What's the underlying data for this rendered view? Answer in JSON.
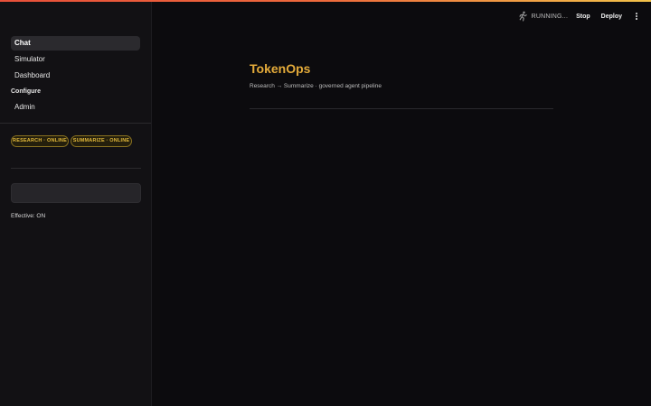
{
  "header": {
    "status_text": "RUNNING...",
    "stop_label": "Stop",
    "deploy_label": "Deploy"
  },
  "sidebar": {
    "nav_items": [
      {
        "label": "Chat",
        "active": true
      },
      {
        "label": "Simulator",
        "active": false
      },
      {
        "label": "Dashboard",
        "active": false
      }
    ],
    "configure_label": "Configure",
    "configure_items": [
      {
        "label": "Admin"
      }
    ],
    "badges": [
      {
        "label": "RESEARCH · ONLINE"
      },
      {
        "label": "SUMMARIZE · ONLINE"
      }
    ],
    "input_value": "",
    "effective_text": "Effective: ON"
  },
  "main": {
    "title": "TokenOps",
    "subtitle": "Research → Summarize · governed agent pipeline"
  },
  "colors": {
    "accent_gold": "#e4ab3a",
    "badge_text": "#e2b93b",
    "background": "#0c0b0e",
    "sidebar_bg": "#121114",
    "topline_start": "#e8503a",
    "topline_end": "#f3c24a"
  }
}
